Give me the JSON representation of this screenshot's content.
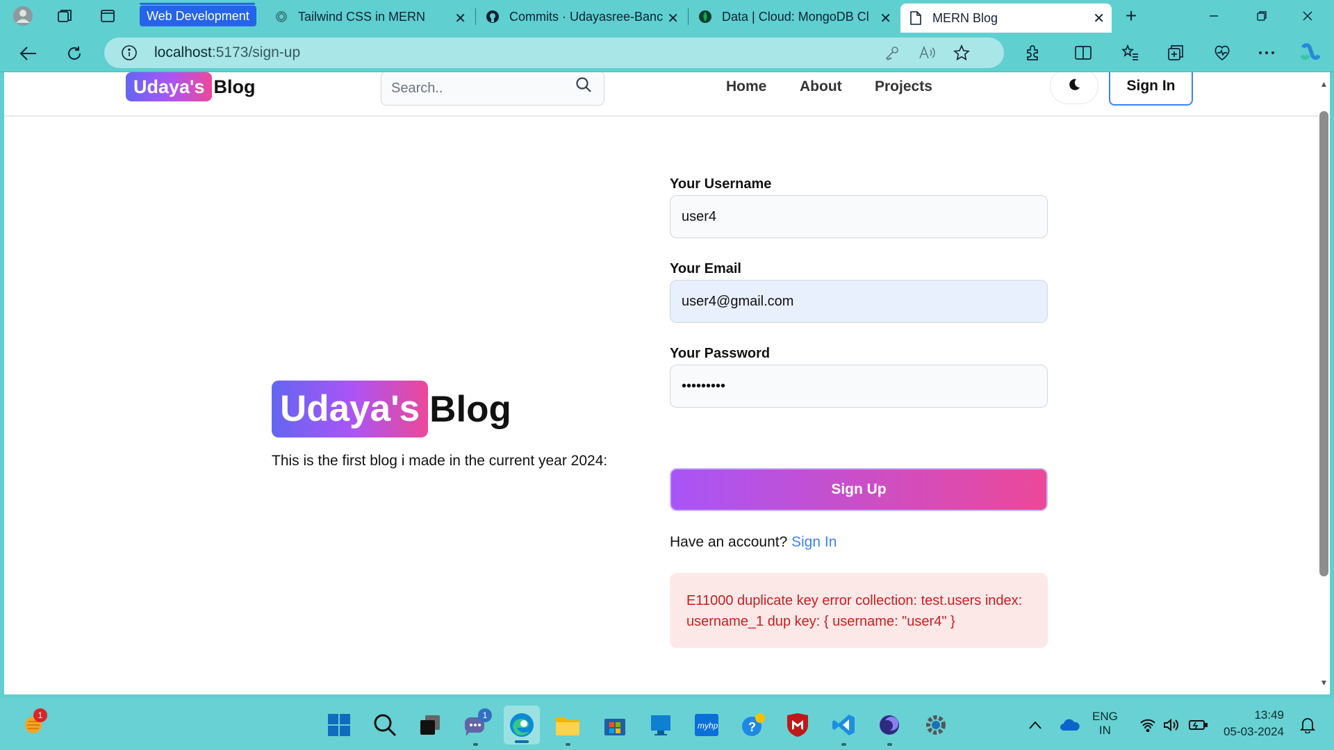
{
  "browser": {
    "tab_group_label": "Web Development",
    "tabs": [
      {
        "title": "Tailwind CSS in MERN",
        "icon": "chatgpt-icon"
      },
      {
        "title": "Commits · Udayasree-Banc",
        "icon": "github-icon"
      },
      {
        "title": "Data | Cloud: MongoDB Cl",
        "icon": "mongodb-leaf-icon"
      },
      {
        "title": "MERN Blog",
        "icon": "page-icon",
        "active": true
      }
    ],
    "new_tab_label": "+",
    "url_host": "localhost",
    "url_path": ":5173/sign-up"
  },
  "site": {
    "logo_highlight": "Udaya's",
    "logo_rest": "Blog",
    "search_placeholder": "Search..",
    "nav": [
      "Home",
      "About",
      "Projects"
    ],
    "header_signin": "Sign In"
  },
  "hero": {
    "logo_highlight": "Udaya's",
    "logo_rest": "Blog",
    "description": "This is the first blog i made in the current year 2024:"
  },
  "form": {
    "username_label": "Your Username",
    "username_value": "user4",
    "email_label": "Your Email",
    "email_value": "user4@gmail.com",
    "password_label": "Your Password",
    "password_value": "123456789",
    "submit_label": "Sign Up",
    "have_account": "Have an account?",
    "signin_link": "Sign In",
    "error_message": "E11000 duplicate key error collection: test.users index: username_1 dup key: { username: \"user4\" }"
  },
  "taskbar": {
    "notification_badge": "1",
    "teams_badge": "1",
    "language_line1": "ENG",
    "language_line2": "IN",
    "time": "13:49",
    "date": "05-03-2024"
  },
  "colors": {
    "chrome_bg": "#5fcfd0",
    "accent_gradient_start": "#a855f7",
    "accent_gradient_end": "#ec4899",
    "link_blue": "#3b82f6",
    "error_text": "#c81e1e",
    "error_bg": "#fde8e8"
  }
}
